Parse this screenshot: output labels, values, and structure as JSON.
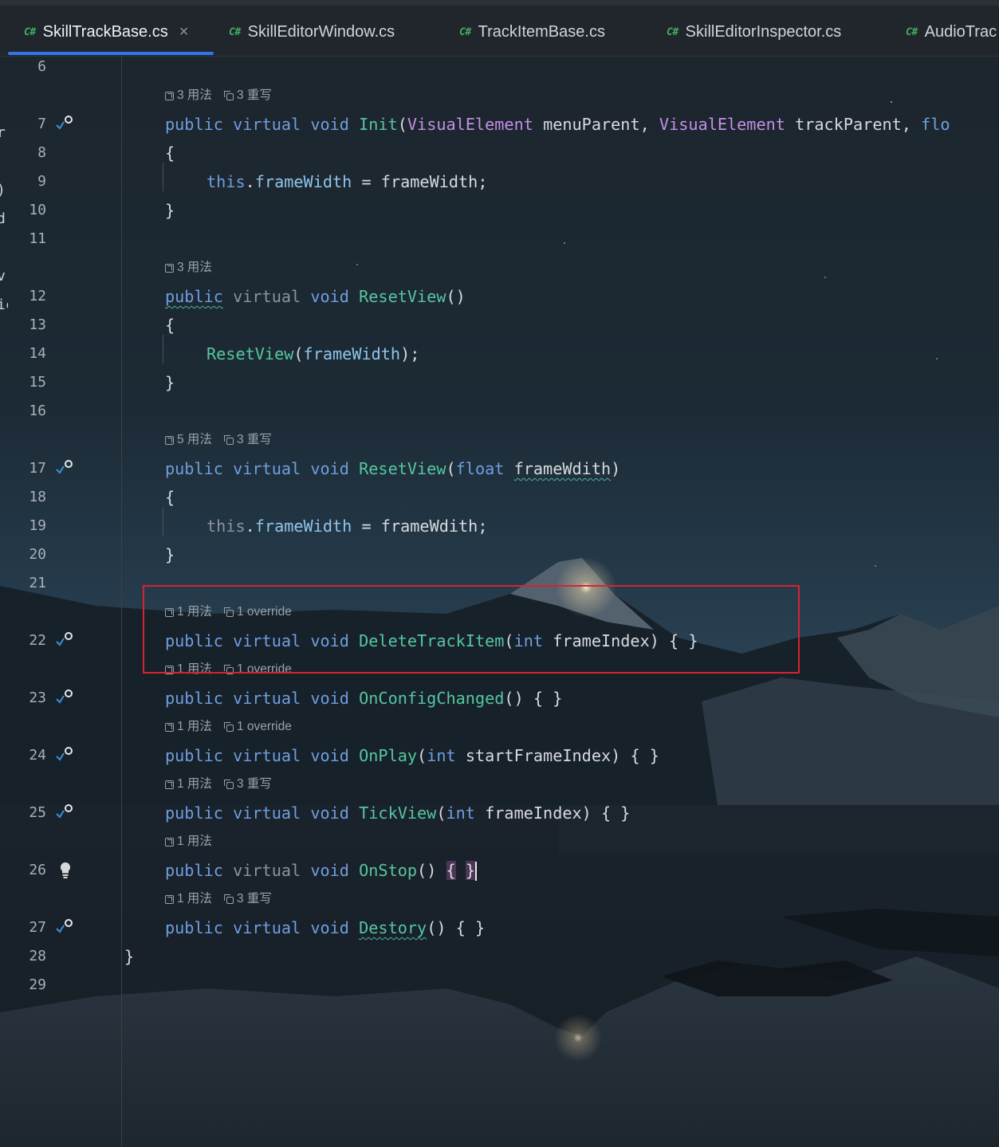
{
  "tabs": [
    {
      "lang": "C#",
      "label": "SkillTrackBase.cs",
      "active": true,
      "close": "×"
    },
    {
      "lang": "C#",
      "label": "SkillEditorWindow.cs",
      "active": false
    },
    {
      "lang": "C#",
      "label": "TrackItemBase.cs",
      "active": false
    },
    {
      "lang": "C#",
      "label": "SkillEditorInspector.cs",
      "active": false
    },
    {
      "lang": "C#",
      "label": "AudioTrac",
      "active": false
    }
  ],
  "left_strip_chars": [
    "r",
    "):",
    "d",
    "v",
    "ic"
  ],
  "hints": {
    "h7": {
      "usages": "3 用法",
      "overrides": "3 重写"
    },
    "h12": {
      "usages": "3 用法"
    },
    "h17": {
      "usages": "5 用法",
      "overrides": "3 重写"
    },
    "h22": {
      "usages": "1 用法",
      "overrides": "1 override"
    },
    "h23": {
      "usages": "1 用法",
      "overrides": "1 override"
    },
    "h24": {
      "usages": "1 用法",
      "overrides": "1 override"
    },
    "h25": {
      "usages": "1 用法",
      "overrides": "3 重写"
    },
    "h26": {
      "usages": "1 用法"
    },
    "h27": {
      "usages": "1 用法",
      "overrides": "3 重写"
    }
  },
  "code": {
    "public": "public",
    "virtual": "virtual",
    "void": "void",
    "this": "this",
    "float": "float",
    "int": "int",
    "l7": {
      "name": "Init",
      "t1": "VisualElement",
      "p1": "menuParent",
      "t2": "VisualElement",
      "p2": "trackParent",
      "rest": "flo"
    },
    "l9": {
      "field": "frameWidth",
      "rhs": "frameWidth"
    },
    "l12": {
      "name": "ResetView"
    },
    "l14": {
      "call": "ResetView",
      "arg": "frameWidth"
    },
    "l17": {
      "name": "ResetView",
      "param": "frameWdith"
    },
    "l19": {
      "field": "frameWidth",
      "rhs": "frameWdith"
    },
    "l22": {
      "name": "DeleteTrackItem",
      "param": "frameIndex"
    },
    "l23": {
      "name": "OnConfigChanged"
    },
    "l24": {
      "name": "OnPlay",
      "param": "startFrameIndex"
    },
    "l25": {
      "name": "TickView",
      "param": "frameIndex"
    },
    "l26": {
      "name": "OnStop"
    },
    "l27": {
      "name": "Destory"
    }
  },
  "line_numbers": [
    "6",
    "7",
    "8",
    "9",
    "10",
    "11",
    "12",
    "13",
    "14",
    "15",
    "16",
    "17",
    "18",
    "19",
    "20",
    "21",
    "22",
    "23",
    "24",
    "25",
    "26",
    "27",
    "28",
    "29"
  ],
  "gutter_icons": {
    "l7": "override-down-icon",
    "l17": "override-down-icon",
    "l22": "override-down-icon",
    "l23": "override-down-icon",
    "l24": "override-down-icon",
    "l25": "override-down-icon",
    "l26": "lightbulb-icon",
    "l27": "override-down-icon"
  },
  "colors": {
    "accent": "#3574f0",
    "keyword": "#6f9ee0",
    "method": "#56c6a0",
    "type": "#c58ee8",
    "highlight_box": "#d8232f"
  }
}
